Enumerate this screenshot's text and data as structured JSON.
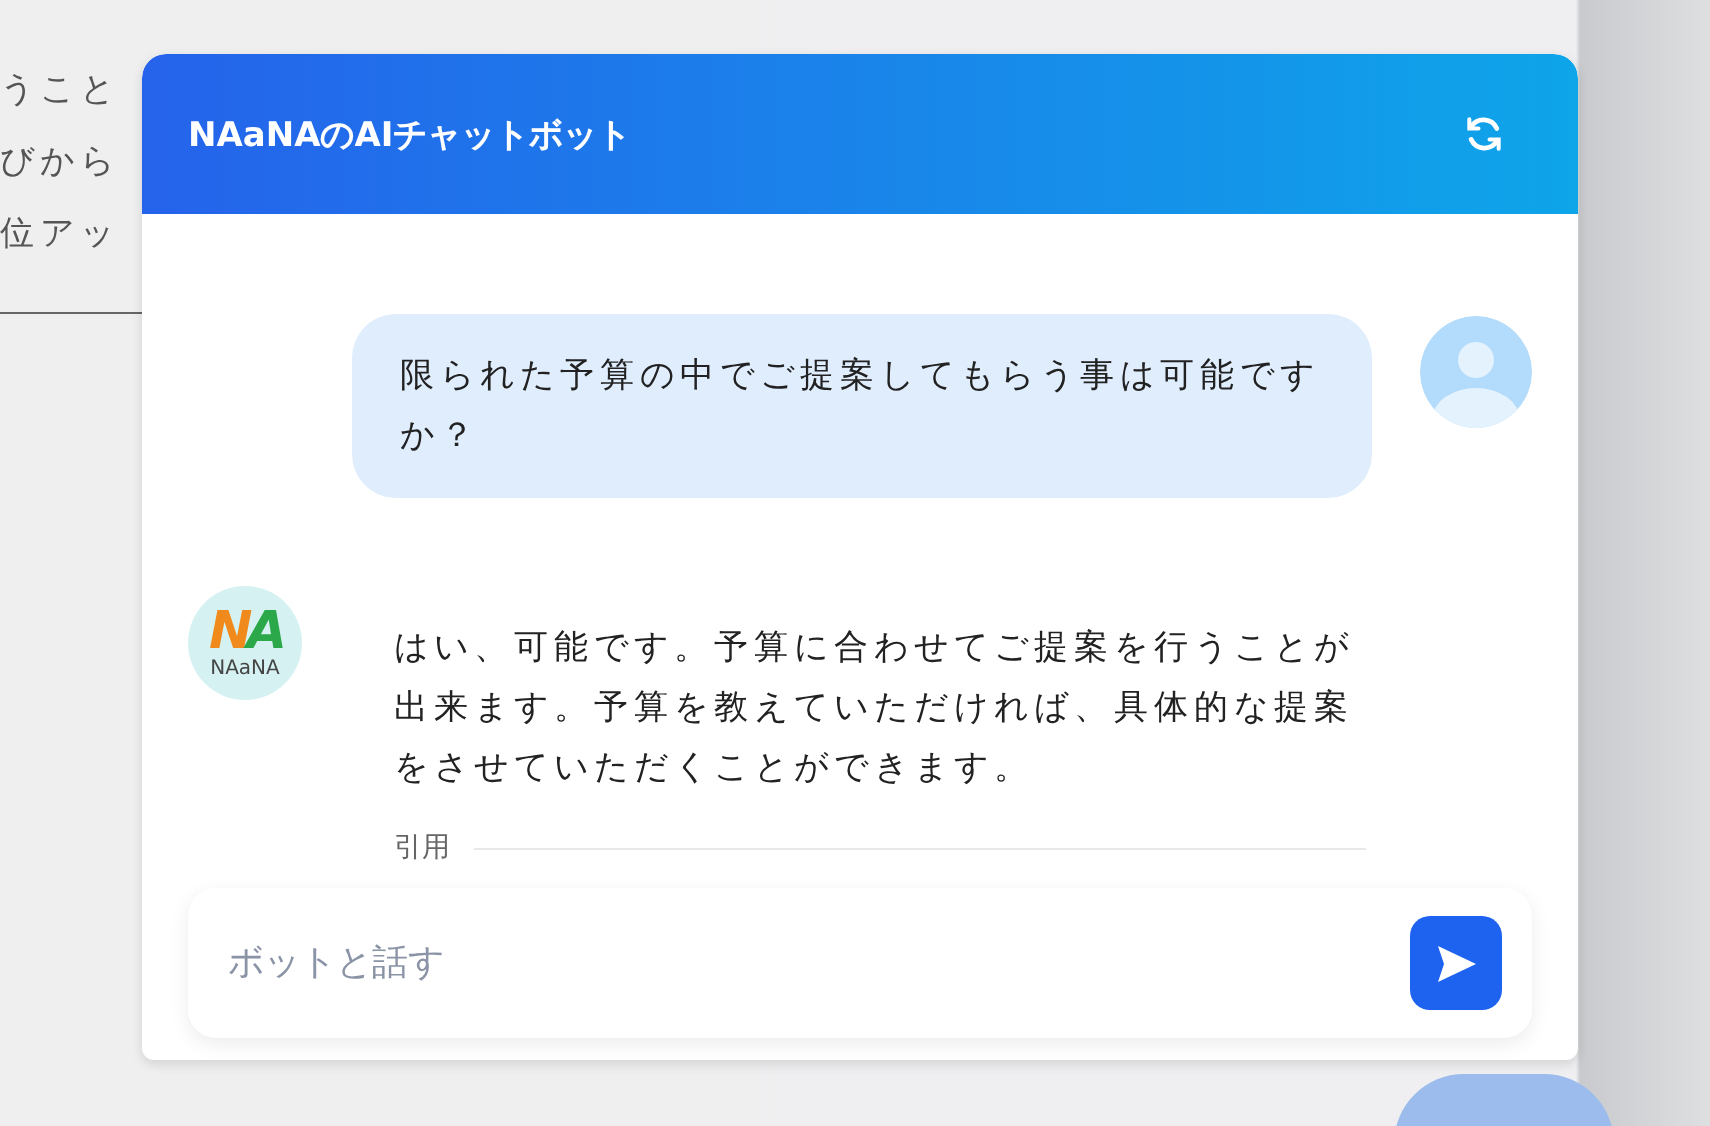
{
  "background_page": {
    "lines": [
      "うこと",
      "びから",
      "位アッ"
    ]
  },
  "chat": {
    "title": "NAaNAのAIチャットボット",
    "messages": [
      {
        "kind": "user",
        "text": "限られた予算の中でご提案してもらう事は可能ですか？"
      },
      {
        "kind": "bot",
        "text": "はい、可能です。予算に合わせてご提案を行うことが出来ます。予算を教えていただければ、具体的な提案をさせていただくことができます。",
        "citation_label": "引用",
        "avatar": {
          "mark": [
            {
              "text": "N",
              "color": "#f08a1c"
            },
            {
              "text": "A",
              "color": "#2aa84a"
            }
          ],
          "caption": "NAaNA"
        }
      }
    ],
    "input": {
      "placeholder": "ボットと話す"
    }
  }
}
